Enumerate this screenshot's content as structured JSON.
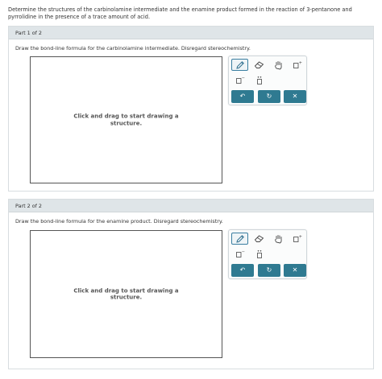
{
  "question": "Determine the structures of the carbinolamine intermediate and the enamine product formed in the reaction of 3-pentanone and pyrrolidine in the presence of a trace amount of acid.",
  "parts": [
    {
      "header": "Part 1 of 2",
      "instruction": "Draw the bond-line formula for the carbinolamine intermediate. Disregard stereochemistry.",
      "canvas_hint": "Click and drag to start drawing a structure."
    },
    {
      "header": "Part 2 of 2",
      "instruction": "Draw the bond-line formula for the enamine product. Disregard stereochemistry.",
      "canvas_hint": "Click and drag to start drawing a structure."
    }
  ],
  "toolbar": {
    "undo_glyph": "↶",
    "redo_glyph": "↻",
    "clear_glyph": "✕",
    "charge_label": "−",
    "plus_label": "+"
  },
  "colors": {
    "accent": "#2f7a91",
    "header_bg": "#dfe5e8",
    "active_tool_border": "#3a7ea1"
  },
  "icons": [
    "pencil-icon",
    "eraser-icon",
    "hand-icon",
    "add-atom-icon",
    "charge-icon",
    "lone-pair-icon",
    "undo-icon",
    "redo-icon",
    "close-icon"
  ]
}
